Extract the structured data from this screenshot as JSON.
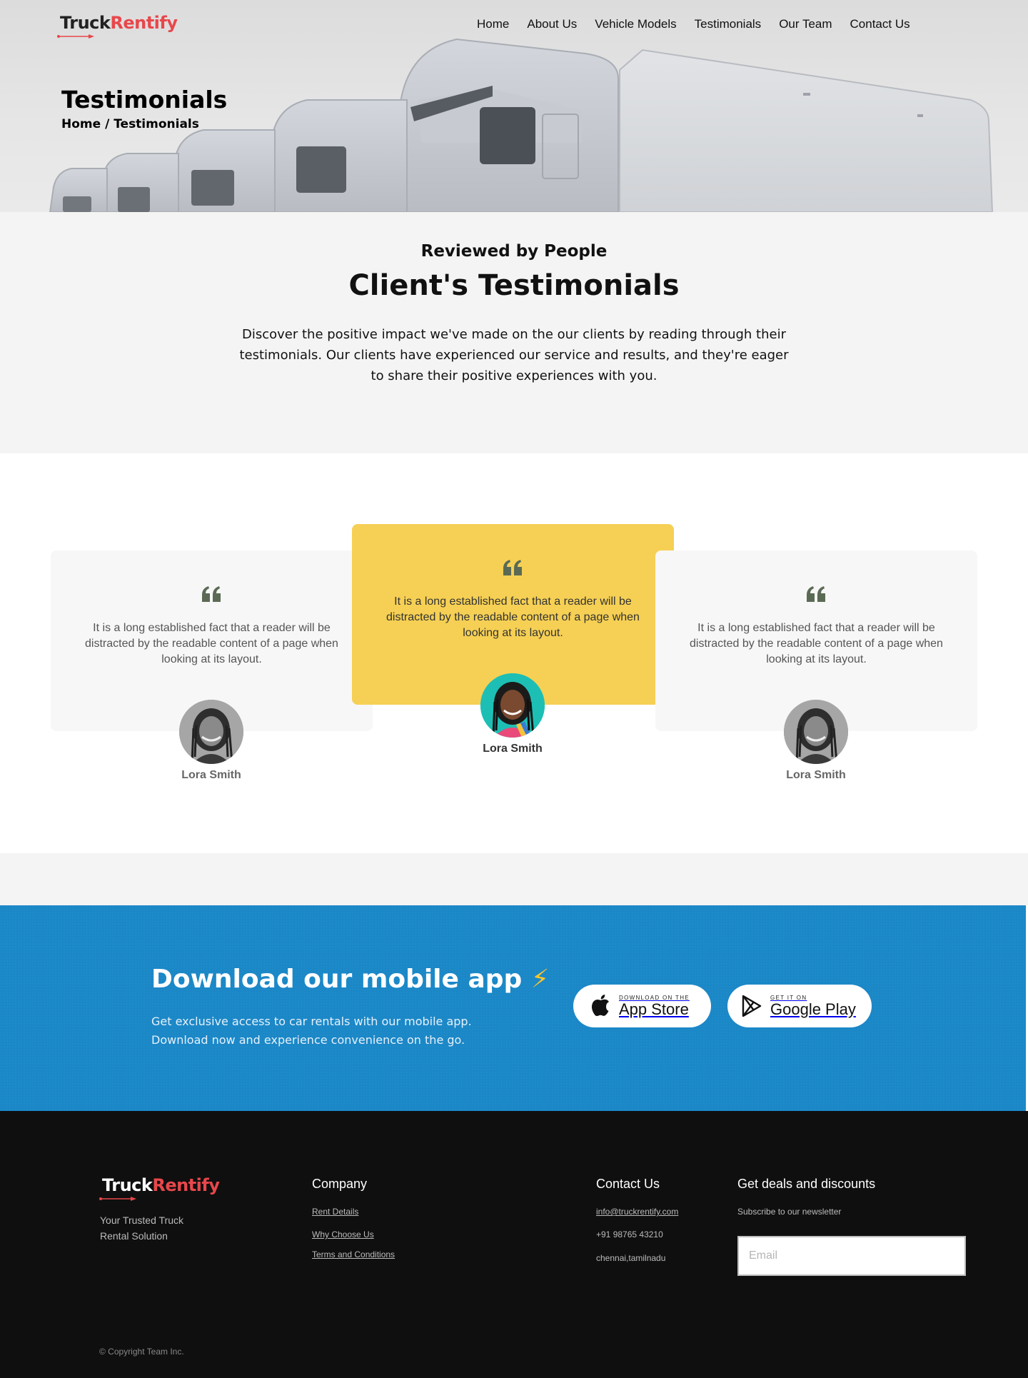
{
  "brand": {
    "name_part1": "Truck",
    "name_part2": "Rentify",
    "accent_color": "#e8474b"
  },
  "nav": {
    "items": [
      {
        "label": "Home"
      },
      {
        "label": "About Us"
      },
      {
        "label": "Vehicle Models"
      },
      {
        "label": "Testimonials"
      },
      {
        "label": "Our Team"
      },
      {
        "label": "Contact Us"
      }
    ]
  },
  "hero": {
    "title": "Testimonials",
    "breadcrumb": "Home / Testimonials"
  },
  "intro": {
    "kicker": "Reviewed by People",
    "heading": "Client's Testimonials",
    "body": "Discover the positive impact we've made on the our clients by reading through their testimonials. Our clients have experienced our service and results, and they're eager to share their positive experiences with you."
  },
  "testimonials": [
    {
      "text": "It is a long established fact that a reader will be distracted by the readable content of a page when looking at its layout.",
      "name": "Lora Smith"
    },
    {
      "text": "It is a long established fact that a reader will be distracted by the readable content of a page when looking at its layout.",
      "name": "Lora Smith",
      "highlight_color": "#f6d054"
    },
    {
      "text": "It is a long established fact that a reader will be distracted by the readable content of a page when looking at its layout.",
      "name": "Lora Smith"
    }
  ],
  "app_cta": {
    "heading": "Download our mobile app",
    "icon": "lightning-icon",
    "body": "Get exclusive access to car rentals with our mobile app. Download now and experience convenience on the go.",
    "bg_color": "#1a87c7",
    "app_store": {
      "small": "DOWNLOAD ON THE",
      "big": "App Store"
    },
    "google_play": {
      "small": "GET IT ON",
      "big": "Google Play"
    }
  },
  "footer": {
    "tagline": "Your Trusted Truck Rental Solution",
    "company": {
      "heading": "Company",
      "links": [
        "Rent Details",
        "Why Choose Us",
        "Terms and Conditions"
      ]
    },
    "contact": {
      "heading": "Contact Us",
      "email": "info@truckrentify.com",
      "phone": "+91 98765 43210",
      "location": "chennai,tamilnadu"
    },
    "deals": {
      "heading": "Get deals and discounts",
      "subtext": "Subscribe to our newsletter",
      "email_placeholder": "Email"
    },
    "copyright": "© Copyright Team Inc."
  }
}
